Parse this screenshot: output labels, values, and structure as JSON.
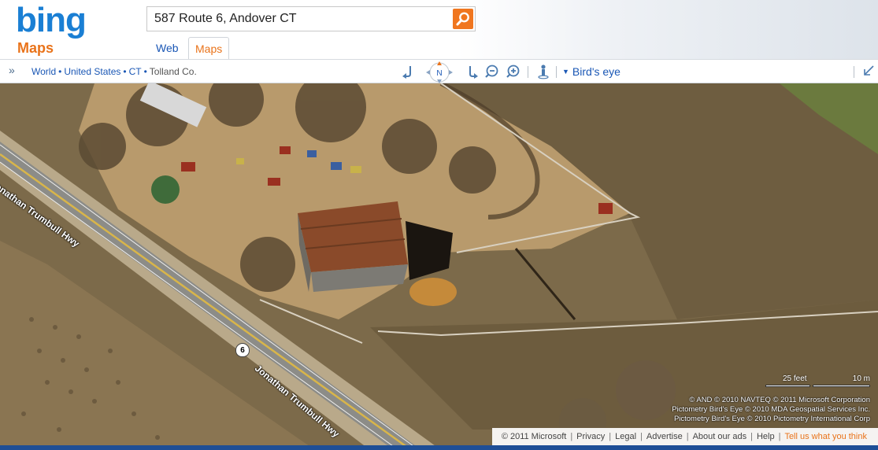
{
  "header": {
    "logo_text": "bing",
    "product": "Maps",
    "search": {
      "value": "587 Route 6, Andover CT",
      "button_icon": "search-icon"
    },
    "tabs": [
      {
        "label": "Web",
        "active": false
      },
      {
        "label": "Maps",
        "active": true
      }
    ]
  },
  "toolbar": {
    "breadcrumb": [
      "World",
      "United States",
      "CT",
      "Tolland Co."
    ],
    "compass_label": "N",
    "view_dropdown": "Bird's eye",
    "icons": [
      "expand-icon",
      "rotate-left-icon",
      "compass-icon",
      "rotate-right-icon",
      "zoom-out-icon",
      "zoom-in-icon",
      "streetside-person-icon",
      "collapse-icon"
    ]
  },
  "map": {
    "road_labels": [
      "Jonathan Trumbull Hwy",
      "Jonathan Trumbull Hwy"
    ],
    "route_shield": "6",
    "scale": {
      "feet": "25 feet",
      "meters": "10 m"
    },
    "copyright_lines": [
      "© AND   © 2010 NAVTEQ   © 2011 Microsoft Corporation",
      "Pictometry Bird's Eye © 2010 MDA Geospatial Services Inc.",
      "Pictometry Bird's Eye © 2010 Pictometry International Corp"
    ]
  },
  "footer": {
    "copyright": "© 2011 Microsoft",
    "links": [
      "Privacy",
      "Legal",
      "Advertise",
      "About our ads",
      "Help"
    ],
    "feedback": "Tell us what you think"
  },
  "colors": {
    "brand_blue": "#1a7fd4",
    "accent_orange": "#e9731a",
    "link_blue": "#1a57b5",
    "bottom_bar": "#1e4e96"
  }
}
